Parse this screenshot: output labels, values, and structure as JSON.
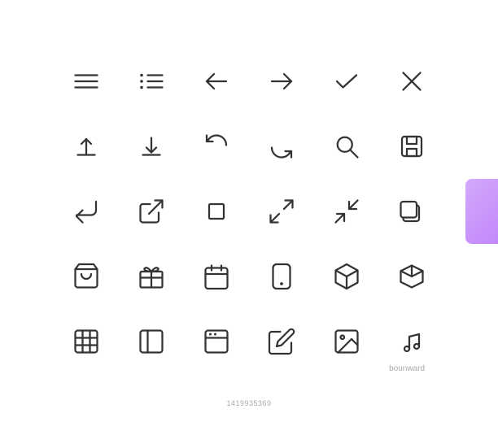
{
  "grid": {
    "rows": [
      [
        {
          "name": "hamburger-menu-icon",
          "type": "hamburger"
        },
        {
          "name": "list-icon",
          "type": "list"
        },
        {
          "name": "arrow-left-icon",
          "type": "arrow-left"
        },
        {
          "name": "arrow-right-icon",
          "type": "arrow-right"
        },
        {
          "name": "checkmark-icon",
          "type": "check"
        },
        {
          "name": "close-icon",
          "type": "close"
        }
      ],
      [
        {
          "name": "upload-icon",
          "type": "upload"
        },
        {
          "name": "download-icon",
          "type": "download"
        },
        {
          "name": "refresh-icon",
          "type": "refresh"
        },
        {
          "name": "sync-icon",
          "type": "sync"
        },
        {
          "name": "search-icon",
          "type": "search"
        },
        {
          "name": "save-icon",
          "type": "save"
        }
      ],
      [
        {
          "name": "share-icon",
          "type": "share"
        },
        {
          "name": "external-link-icon",
          "type": "external-link"
        },
        {
          "name": "crop-icon",
          "type": "crop"
        },
        {
          "name": "expand-icon",
          "type": "expand"
        },
        {
          "name": "compress-icon",
          "type": "compress"
        },
        {
          "name": "layers-icon",
          "type": "layers"
        }
      ],
      [
        {
          "name": "shopping-bag-icon",
          "type": "shopping-bag"
        },
        {
          "name": "gift-icon",
          "type": "gift"
        },
        {
          "name": "calendar-icon",
          "type": "calendar"
        },
        {
          "name": "phone-icon",
          "type": "phone"
        },
        {
          "name": "cube-icon",
          "type": "cube"
        },
        {
          "name": "box-icon",
          "type": "box3d"
        }
      ],
      [
        {
          "name": "table-icon",
          "type": "table"
        },
        {
          "name": "sidebar-icon",
          "type": "sidebar"
        },
        {
          "name": "browser-icon",
          "type": "browser"
        },
        {
          "name": "edit-icon",
          "type": "edit"
        },
        {
          "name": "image-icon",
          "type": "image"
        },
        {
          "name": "music-icon",
          "type": "music"
        }
      ]
    ]
  },
  "watermark": {
    "text": "bounward",
    "getty_id": "1419935369"
  }
}
